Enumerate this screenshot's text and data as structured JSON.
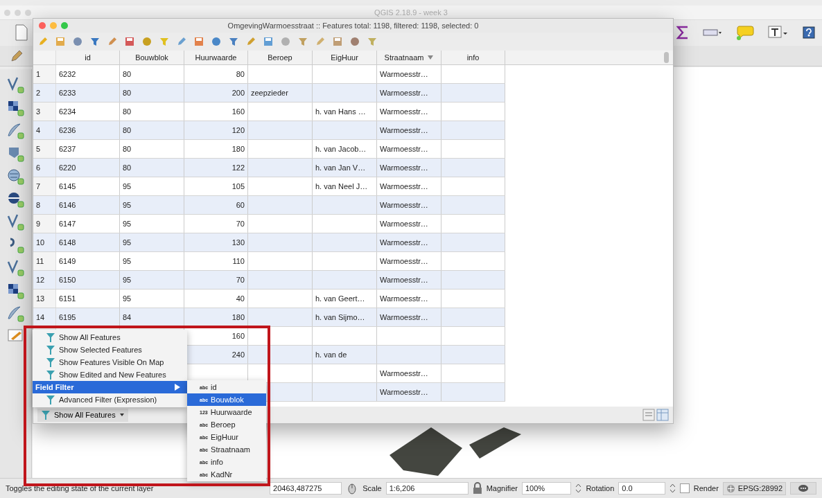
{
  "main_window": {
    "title": "QGIS 2.18.9 - week 3"
  },
  "attribute_table": {
    "title": "OmgevingWarmoesstraat :: Features total: 1198, filtered: 1198, selected: 0",
    "columns": [
      {
        "label": "id",
        "sorted": false
      },
      {
        "label": "Bouwblok",
        "sorted": false
      },
      {
        "label": "Huurwaarde",
        "sorted": false
      },
      {
        "label": "Beroep",
        "sorted": false
      },
      {
        "label": "EigHuur",
        "sorted": false
      },
      {
        "label": "Straatnaam",
        "sorted": true
      },
      {
        "label": "info",
        "sorted": false
      }
    ],
    "rows": [
      {
        "index": "1",
        "cells": [
          "6232",
          "80",
          "80",
          null,
          null,
          "Warmoesstr…",
          null
        ]
      },
      {
        "index": "2",
        "cells": [
          "6233",
          "80",
          "200",
          "zeepzieder",
          null,
          "Warmoesstr…",
          null
        ]
      },
      {
        "index": "3",
        "cells": [
          "6234",
          "80",
          "160",
          null,
          "h. van Hans …",
          "Warmoesstr…",
          null
        ]
      },
      {
        "index": "4",
        "cells": [
          "6236",
          "80",
          "120",
          null,
          null,
          "Warmoesstr…",
          null
        ]
      },
      {
        "index": "5",
        "cells": [
          "6237",
          "80",
          "180",
          null,
          "h. van Jacob…",
          "Warmoesstr…",
          null
        ]
      },
      {
        "index": "6",
        "cells": [
          "6220",
          "80",
          "122",
          null,
          "h. van Jan V…",
          "Warmoesstr…",
          null
        ]
      },
      {
        "index": "7",
        "cells": [
          "6145",
          "95",
          "105",
          null,
          "h. van Neel J…",
          "Warmoesstr…",
          null
        ]
      },
      {
        "index": "8",
        "cells": [
          "6146",
          "95",
          "60",
          null,
          null,
          "Warmoesstr…",
          null
        ]
      },
      {
        "index": "9",
        "cells": [
          "6147",
          "95",
          "70",
          null,
          null,
          "Warmoesstr…",
          null
        ]
      },
      {
        "index": "10",
        "cells": [
          "6148",
          "95",
          "130",
          null,
          null,
          "Warmoesstr…",
          null
        ]
      },
      {
        "index": "11",
        "cells": [
          "6149",
          "95",
          "110",
          null,
          null,
          "Warmoesstr…",
          null
        ]
      },
      {
        "index": "12",
        "cells": [
          "6150",
          "95",
          "70",
          null,
          null,
          "Warmoesstr…",
          null
        ]
      },
      {
        "index": "13",
        "cells": [
          "6151",
          "95",
          "40",
          null,
          "h. van Geert…",
          "Warmoesstr…",
          null
        ]
      },
      {
        "index": "14",
        "cells": [
          "6195",
          "84",
          "180",
          null,
          "h. van Sijmo…",
          "Warmoesstr…",
          null
        ]
      },
      {
        "cells": [
          null,
          null,
          "160",
          null,
          null,
          null,
          null
        ]
      },
      {
        "cells": [
          null,
          null,
          "240",
          null,
          "h. van de",
          null,
          null
        ]
      },
      {
        "cells": [
          null,
          null,
          null,
          null,
          null,
          "Warmoesstr…",
          null
        ]
      },
      {
        "cells": [
          null,
          null,
          null,
          null,
          null,
          "Warmoesstr…",
          null
        ]
      }
    ],
    "filter_button": "Show All Features"
  },
  "filter_menu": {
    "items": [
      {
        "kind": "filter",
        "label": "Show All Features",
        "selected": false
      },
      {
        "kind": "filter",
        "label": "Show Selected Features",
        "selected": false
      },
      {
        "kind": "filter",
        "label": "Show Features Visible On Map",
        "selected": false
      },
      {
        "kind": "filter",
        "label": "Show Edited and New Features",
        "selected": false
      },
      {
        "kind": "submenu",
        "label": "Field Filter",
        "selected": true
      },
      {
        "kind": "filter",
        "label": "Advanced Filter (Expression)",
        "selected": false
      }
    ]
  },
  "field_submenu": {
    "items": [
      {
        "type": "abc",
        "label": "id",
        "selected": false
      },
      {
        "type": "abc",
        "label": "Bouwblok",
        "selected": true
      },
      {
        "type": "123",
        "label": "Huurwaarde",
        "selected": false
      },
      {
        "type": "abc",
        "label": "Beroep",
        "selected": false
      },
      {
        "type": "abc",
        "label": "EigHuur",
        "selected": false
      },
      {
        "type": "abc",
        "label": "Straatnaam",
        "selected": false
      },
      {
        "type": "abc",
        "label": "info",
        "selected": false
      },
      {
        "type": "abc",
        "label": "KadNr",
        "selected": false
      }
    ]
  },
  "status_bar": {
    "message": "Toggles the editing state of the current layer",
    "coordinate": "20463,487275",
    "scale_label": "Scale",
    "scale": "1:6,206",
    "magnifier_label": "Magnifier",
    "magnifier": "100%",
    "rotation_label": "Rotation",
    "rotation": "0.0",
    "render": {
      "label": "Render",
      "checked": false
    },
    "crs": "EPSG:28992"
  }
}
